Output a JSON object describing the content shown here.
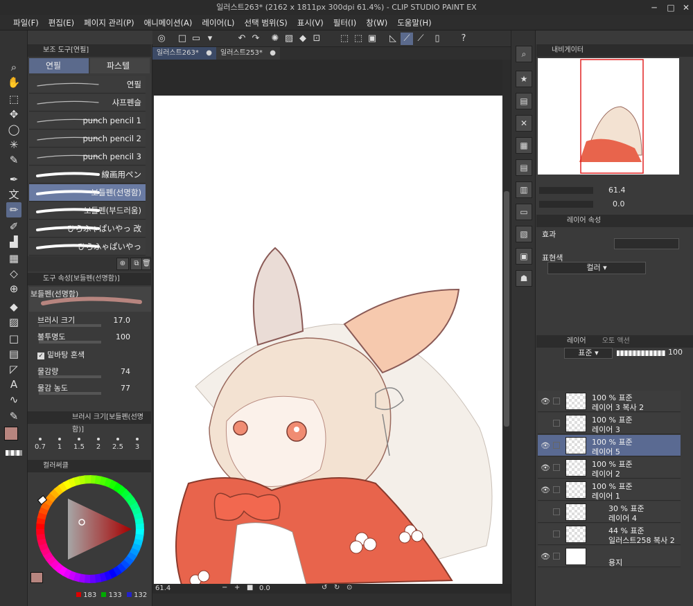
{
  "window": {
    "title": "일러스트263* (2162 x 1811px 300dpi 61.4%)  - CLIP STUDIO PAINT EX",
    "minimize": "─",
    "maximize": "□",
    "close": "✕"
  },
  "menu": [
    "파일(F)",
    "편집(E)",
    "페이지 관리(P)",
    "애니메이션(A)",
    "레이어(L)",
    "선택 범위(S)",
    "표시(V)",
    "필터(I)",
    "창(W)",
    "도움말(H)"
  ],
  "subtool": {
    "header": "보조 도구[연필]",
    "tabs": [
      "연필",
      "파스텔"
    ],
    "brushes": [
      "연필",
      "샤프펜슬",
      "punch pencil 1",
      "punch pencil 2",
      "punch pencil 3",
      "線画用ペン",
      "보들펜(선명함)",
      "보들펜(부드러움)",
      "ひらふゃぱいやっ 改",
      "ひらふゃぱいやっ"
    ]
  },
  "tool_property": {
    "header": "도구 속성[보들펜(선명함)]",
    "preview_label": "보들펜(선명함)",
    "rows": [
      {
        "label": "브러시 크기",
        "value": "17.0"
      },
      {
        "label": "불투명도",
        "value": "100"
      },
      {
        "label": "밑바탕 혼색",
        "value": ""
      },
      {
        "label": "물감량",
        "value": "74"
      },
      {
        "label": "물감 농도",
        "value": "77"
      }
    ]
  },
  "brush_size": {
    "header": "브러시 크기[보들펜(선명함)]",
    "sizes": [
      "0.7",
      "1",
      "1.5",
      "2",
      "2.5",
      "3"
    ]
  },
  "color": {
    "header": "컬러써클",
    "main_hex": "#b7857f",
    "sub_hex": "#5aa8e0",
    "r": "183",
    "g": "133",
    "b": "132"
  },
  "canvas": {
    "tabs": [
      "일러스트263*",
      "일러스트253*"
    ],
    "zoom": "61.4",
    "angle": "0.0"
  },
  "navigator": {
    "header": "내비게이터",
    "zoom": "61.4",
    "angle": "0.0"
  },
  "layer_property": {
    "header": "레이어 속성",
    "effect_label": "효과",
    "expression_label": "표현색",
    "expression_value": "컬러"
  },
  "layers": {
    "header": "레이어",
    "header2": "오토 액션",
    "blend_mode": "표준",
    "opacity": "100",
    "items": [
      {
        "line1": "100 % 표준",
        "line2": "레이어 3 복사 2",
        "visible": true
      },
      {
        "line1": "100 % 표준",
        "line2": "레이어 3",
        "visible": false
      },
      {
        "line1": "100 % 표준",
        "line2": "레이어 5",
        "visible": true
      },
      {
        "line1": "100 % 표준",
        "line2": "레이어 2",
        "visible": true
      },
      {
        "line1": "100 % 표준",
        "line2": "레이어 1",
        "visible": true
      },
      {
        "line1": "30 % 표준",
        "line2": "레이어 4",
        "visible": false
      },
      {
        "line1": "44 % 표준",
        "line2": "일러스트258 복사 2",
        "visible": false
      },
      {
        "line1": "",
        "line2": "용지",
        "visible": true
      }
    ]
  }
}
